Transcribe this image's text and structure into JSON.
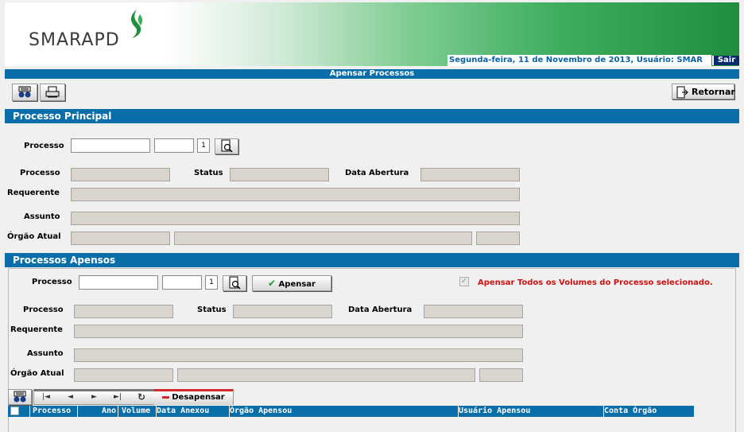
{
  "header": {
    "logo": "SMARAPD",
    "date_user": "Segunda-feira, 11 de Novembro de 2013, Usuário: SMAR",
    "logout": "Sair"
  },
  "page_title": "Apensar Processos",
  "toolbar": {
    "return_label": "Retornar"
  },
  "principal": {
    "title": "Processo Principal",
    "processo_label": "Processo",
    "volume": "1",
    "info_processo_label": "Processo",
    "status_label": "Status",
    "data_abertura_label": "Data Abertura",
    "requerente_label": "Requerente",
    "assunto_label": "Assunto",
    "orgao_label": "Órgão Atual"
  },
  "apensos": {
    "title": "Processos Apensos",
    "processo_label": "Processo",
    "volume": "1",
    "apensar_label": "Apensar",
    "all_volumes_label": "Apensar Todos os Volumes do Processo selecionado.",
    "info_processo_label": "Processo",
    "status_label": "Status",
    "data_abertura_label": "Data Abertura",
    "requerente_label": "Requerente",
    "assunto_label": "Assunto",
    "orgao_label": "Órgão Atual",
    "desapensar_label": "Desapensar"
  },
  "grid": {
    "columns": [
      "Processo",
      "Ano",
      "Volume",
      "Data Anexou",
      "Órgão Apensou",
      "Usuário Apensou",
      "Conta Órgão"
    ]
  },
  "colors": {
    "accent": "#0a6fa8",
    "warning": "#d01010",
    "field_readonly": "#d9d4cc"
  }
}
